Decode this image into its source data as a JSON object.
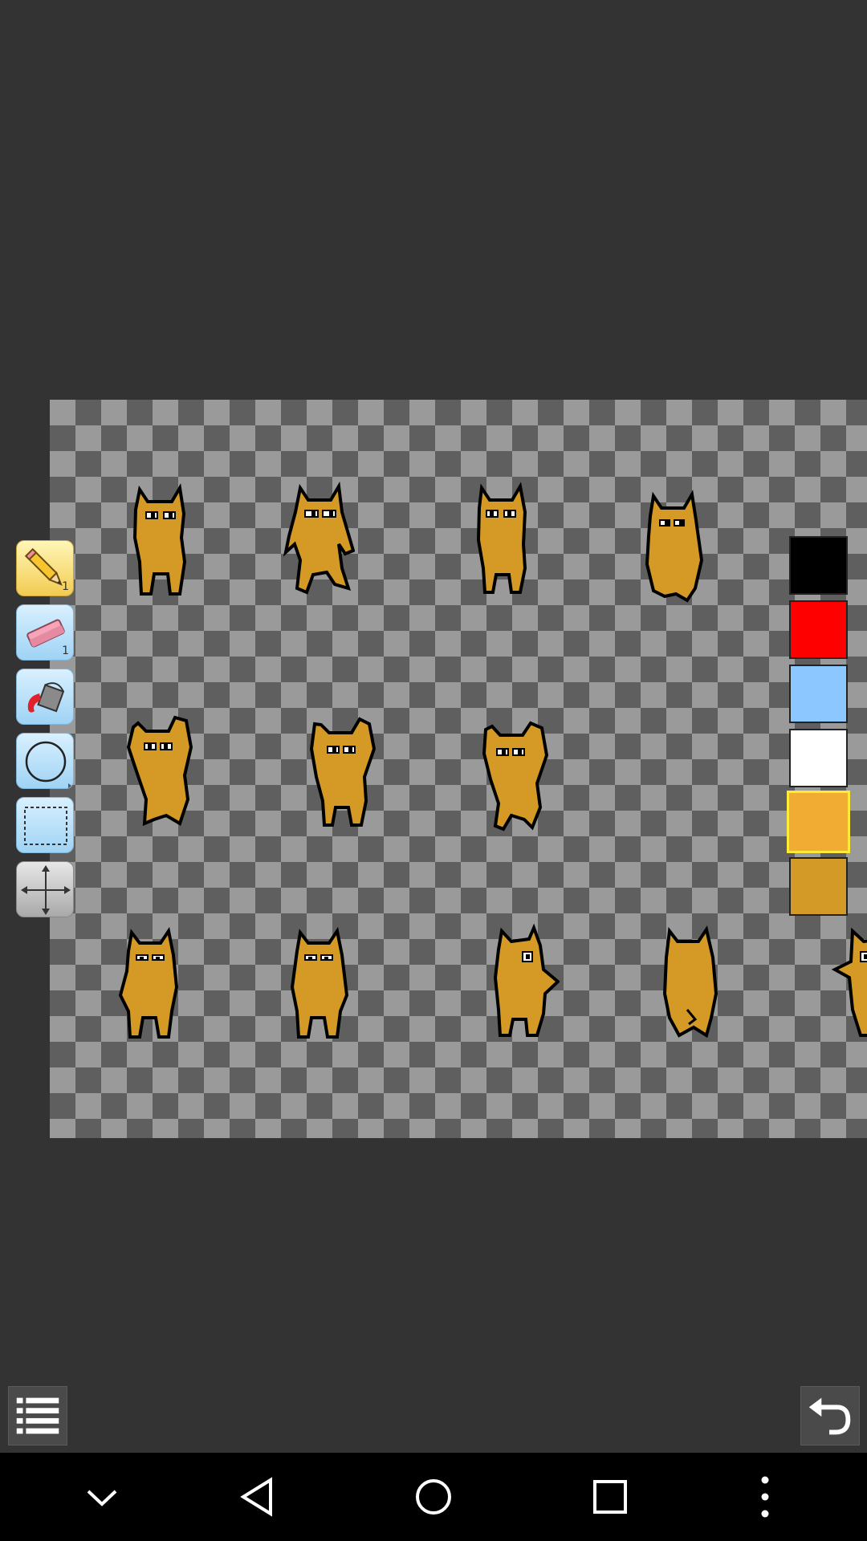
{
  "tools": [
    {
      "name": "pencil",
      "size": "1",
      "active": true
    },
    {
      "name": "eraser",
      "size": "1",
      "active": false
    },
    {
      "name": "fill-bucket",
      "active": false
    },
    {
      "name": "circle",
      "active": false
    },
    {
      "name": "rectangle-select",
      "active": false
    },
    {
      "name": "move",
      "active": false
    }
  ],
  "palette": [
    {
      "color": "#000000",
      "selected": false
    },
    {
      "color": "#ff0000",
      "selected": false
    },
    {
      "color": "#8cc8ff",
      "selected": false
    },
    {
      "color": "#ffffff",
      "selected": false
    },
    {
      "color": "#f0ac33",
      "selected": true
    },
    {
      "color": "#d39a28",
      "selected": false
    }
  ],
  "colors": {
    "background": "#333333",
    "sprite_fill": "#d59a25",
    "sprite_outline": "#000000"
  },
  "bottom": {
    "menu_icon": "list-icon",
    "undo_icon": "undo-icon"
  },
  "navbar": {
    "icons": [
      "chevron-down-icon",
      "back-icon",
      "home-icon",
      "recents-icon",
      "more-icon"
    ]
  }
}
